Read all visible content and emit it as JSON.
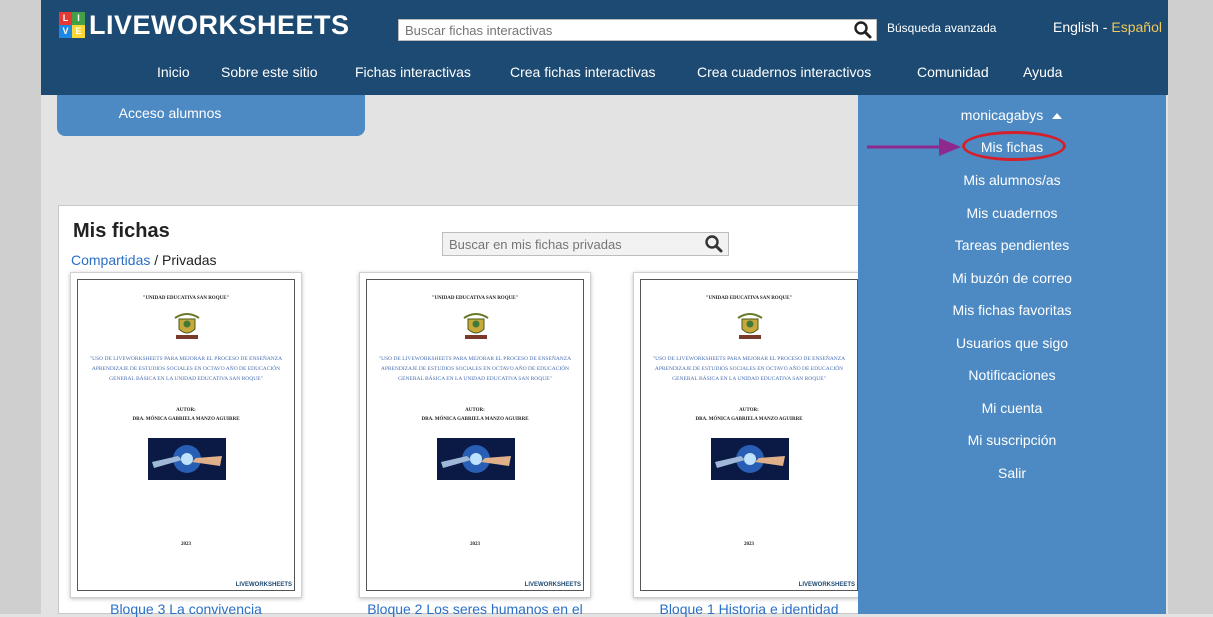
{
  "header": {
    "logo_text": "LIVEWORKSHEETS",
    "logo_letters": [
      "L",
      "I",
      "V",
      "E"
    ],
    "search_placeholder": "Buscar fichas interactivas",
    "advanced_search": "Búsqueda avanzada",
    "lang_en": "English",
    "lang_sep": " - ",
    "lang_es": "Español"
  },
  "nav": {
    "items": [
      "Inicio",
      "Sobre este sitio",
      "Fichas interactivas",
      "Crea fichas interactivas",
      "Crea cuadernos interactivos",
      "Comunidad",
      "Ayuda"
    ]
  },
  "student_access": "Acceso alumnos",
  "main": {
    "title": "Mis fichas",
    "tab_shared": "Compartidas",
    "tab_sep": " / ",
    "tab_private": "Privadas",
    "search_placeholder": "Buscar en mis fichas privadas"
  },
  "worksheet_page": {
    "school": "\"UNIDAD EDUCATIVA SAN ROQUE\"",
    "crest_caption": "SAN ROQUE",
    "description": "\"USO DE LIVEWORKSHEETS PARA MEJORAR EL PROCESO DE ENSEÑANZA APRENDIZAJE DE ESTUDIOS SOCIALES EN OCTAVO AÑO DE EDUCACIÓN GENERAL BÁSICA EN LA UNIDAD EDUCATIVA SAN ROQUE\"",
    "author_label": "AUTOR:",
    "author_name": "DRA. MÓNICA GABRIELA MANZO AGUIRRE",
    "year": "2023",
    "brand": "LIVEWORKSHEETS"
  },
  "cards": [
    {
      "label": "Bloque 3 La convivencia"
    },
    {
      "label": "Bloque 2 Los seres humanos en el"
    },
    {
      "label": "Bloque 1 Historia e identidad"
    }
  ],
  "user_menu": {
    "username": "monicagabys",
    "items": [
      "Mis fichas",
      "Mis alumnos/as",
      "Mis cuadernos",
      "Tareas pendientes",
      "Mi buzón de correo",
      "Mis fichas favoritas",
      "Usuarios que sigo",
      "Notificaciones",
      "Mi cuenta",
      "Mi suscripción",
      "Salir"
    ],
    "highlighted": "Mis fichas"
  },
  "colors": {
    "header_bg": "#1c4a72",
    "menu_bg": "#4d89c3",
    "link": "#2a6fc6",
    "highlight_ring": "#d4202b",
    "annotation_arrow": "#8e2a8e"
  },
  "icons": [
    "search-icon",
    "triangle-up-icon",
    "arrow-right-icon"
  ]
}
